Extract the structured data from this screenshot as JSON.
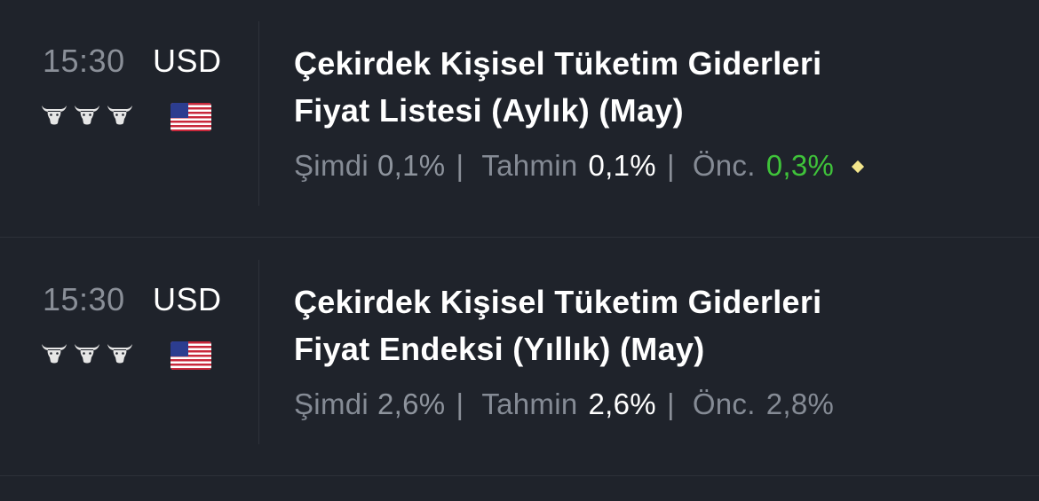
{
  "events": [
    {
      "time": "15:30",
      "currency": "USD",
      "importance": 3,
      "country_flag": "us-flag-icon",
      "title_line1": "Çekirdek Kişisel Tüketim Giderleri",
      "title_line2": "Fiyat Listesi (Aylık) (May)",
      "actual_label": "Şimdi",
      "actual_value": "0,1%",
      "forecast_label": "Tahmin",
      "forecast_value": "0,1%",
      "previous_label": "Önc.",
      "previous_value": "0,3%",
      "previous_color": "#3fc33a",
      "revision_icon": "diamond-icon",
      "separator": "|"
    },
    {
      "time": "15:30",
      "currency": "USD",
      "importance": 3,
      "country_flag": "us-flag-icon",
      "title_line1": "Çekirdek Kişisel Tüketim Giderleri",
      "title_line2": "Fiyat Endeksi (Yıllık) (May)",
      "actual_label": "Şimdi",
      "actual_value": "2,6%",
      "forecast_label": "Tahmin",
      "forecast_value": "2,6%",
      "previous_label": "Önc.",
      "previous_value": "2,8%",
      "separator": "|"
    }
  ],
  "colors": {
    "background": "#1f232b",
    "muted_text": "#858b95",
    "positive": "#3fc33a",
    "revision_marker": "#f3e68c"
  }
}
